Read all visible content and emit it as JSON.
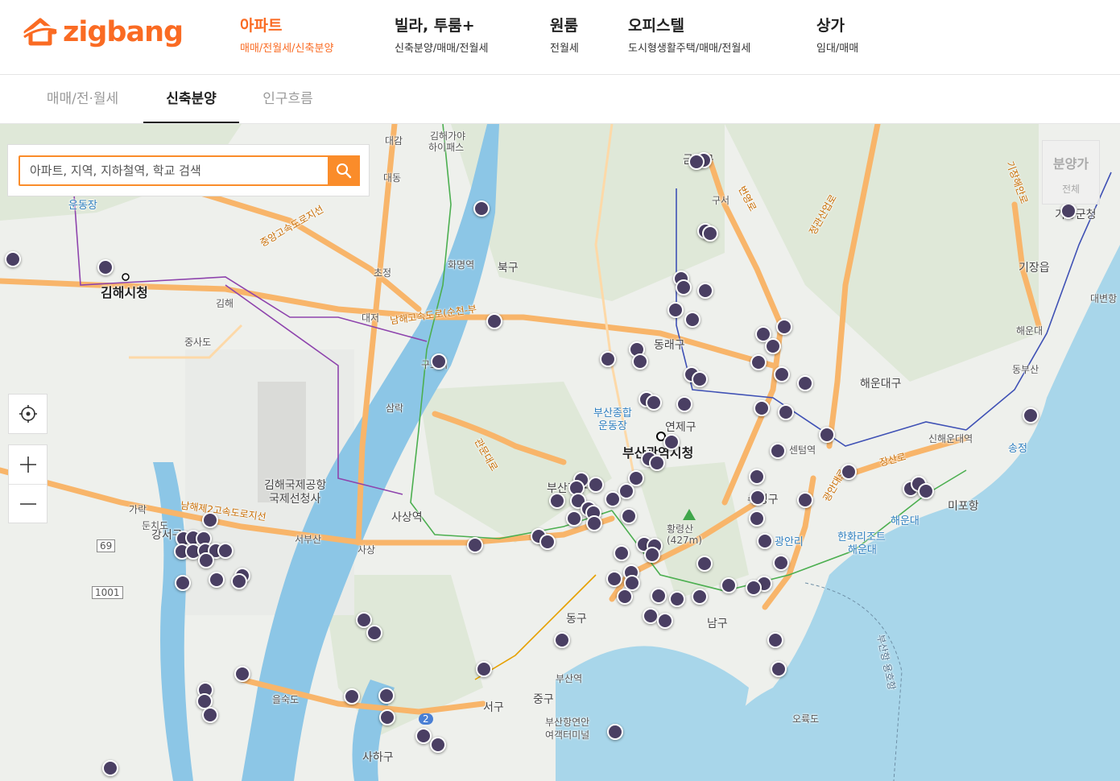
{
  "header": {
    "logo_text": "zigbang",
    "nav": [
      {
        "title": "아파트",
        "sub": "매매/전월세/신축분양",
        "active": true
      },
      {
        "title": "빌라, 투룸+",
        "sub": "신축분양/매매/전월세",
        "active": false
      },
      {
        "title": "원룸",
        "sub": "전월세",
        "active": false
      },
      {
        "title": "오피스텔",
        "sub": "도시형생활주택/매매/전월세",
        "active": false
      },
      {
        "title": "상가",
        "sub": "임대/매매",
        "active": false
      }
    ]
  },
  "tabs": [
    {
      "label": "매매/전·월세",
      "active": false
    },
    {
      "label": "신축분양",
      "active": true
    },
    {
      "label": "인구흐름",
      "active": false
    }
  ],
  "search": {
    "placeholder": "아파트, 지역, 지하철역, 학교 검색"
  },
  "filter": {
    "title": "분양가",
    "value": "전체"
  },
  "colors": {
    "brand": "#fa6b23",
    "search_accent": "#fa8c2a",
    "marker": "#4a3f63",
    "sea": "#a8d6ea",
    "river": "#8cc6e6",
    "highway": "#f8b56a"
  },
  "map": {
    "labels": {
      "gimhae_city": "김해시청",
      "gimhae": "김해",
      "gimhae_ga": "김해가야",
      "gimhae_ga2": "하이패스",
      "daegam": "대감",
      "daedong": "대동",
      "jungsado": "중사도",
      "undongjang": "운동장",
      "hwamyeong": "화명역",
      "bukgu": "북구",
      "jocheong": "초정",
      "daejeo": "대저",
      "gupo": "구포역",
      "samrak": "삼락",
      "airport": "김해국제공항",
      "airport2": "국제선청사",
      "seobusan": "서부산",
      "sasang_st": "사상역",
      "sasang": "사상",
      "gangseo": "강서구",
      "dunchido": "둔치도",
      "garak": "가락",
      "eulsukdo": "을숙도",
      "saha": "사하구",
      "seogu": "서구",
      "junggu": "중구",
      "donggu": "동구",
      "busanjin": "부산진구",
      "busan_station": "부산역",
      "ferry": "부산항연안",
      "ferry2": "여객터미널",
      "namgu": "남구",
      "hwangnyeong": "황령산",
      "hwangnyeong2": "(427m)",
      "yeonje": "연제구",
      "cityhall": "부산광역시청",
      "dongnae": "동래구",
      "sports": "부산종합",
      "sports2": "운동장",
      "suyeong": "수영구",
      "gwangalli": "광안리",
      "centum": "센텀역",
      "haeundae_gu": "해운대구",
      "sinhaeundae": "신해운대역",
      "haeundae_beach": "해운대",
      "hanwha": "한화리조트",
      "hanwha2": "해운대",
      "mipo": "미포항",
      "songjeong": "송정",
      "haeundae_ic": "해운대",
      "dongbusan": "동부산",
      "gijang": "기장읍",
      "gijang_office": "기장군청",
      "daebyeon": "대변항",
      "oryukdo": "오륙도",
      "geumjeong": "금정구",
      "guseo": "구서",
      "route_namhae": "남해고속도로(순천-부",
      "route_namhae2": "남해제2고속도로지선",
      "route_jungang": "중앙고속도로지선",
      "route_ungchi": "번영로",
      "route_gwangan": "광안대로",
      "route_jangsan": "장산로",
      "route_gwanmun": "관문대로",
      "route_jeonggwan": "정관산업로",
      "route_gijang": "기장해안로",
      "route_69": "69",
      "route_1001": "1001",
      "route_2": "2",
      "sea_route": "부산항 용호항"
    }
  }
}
